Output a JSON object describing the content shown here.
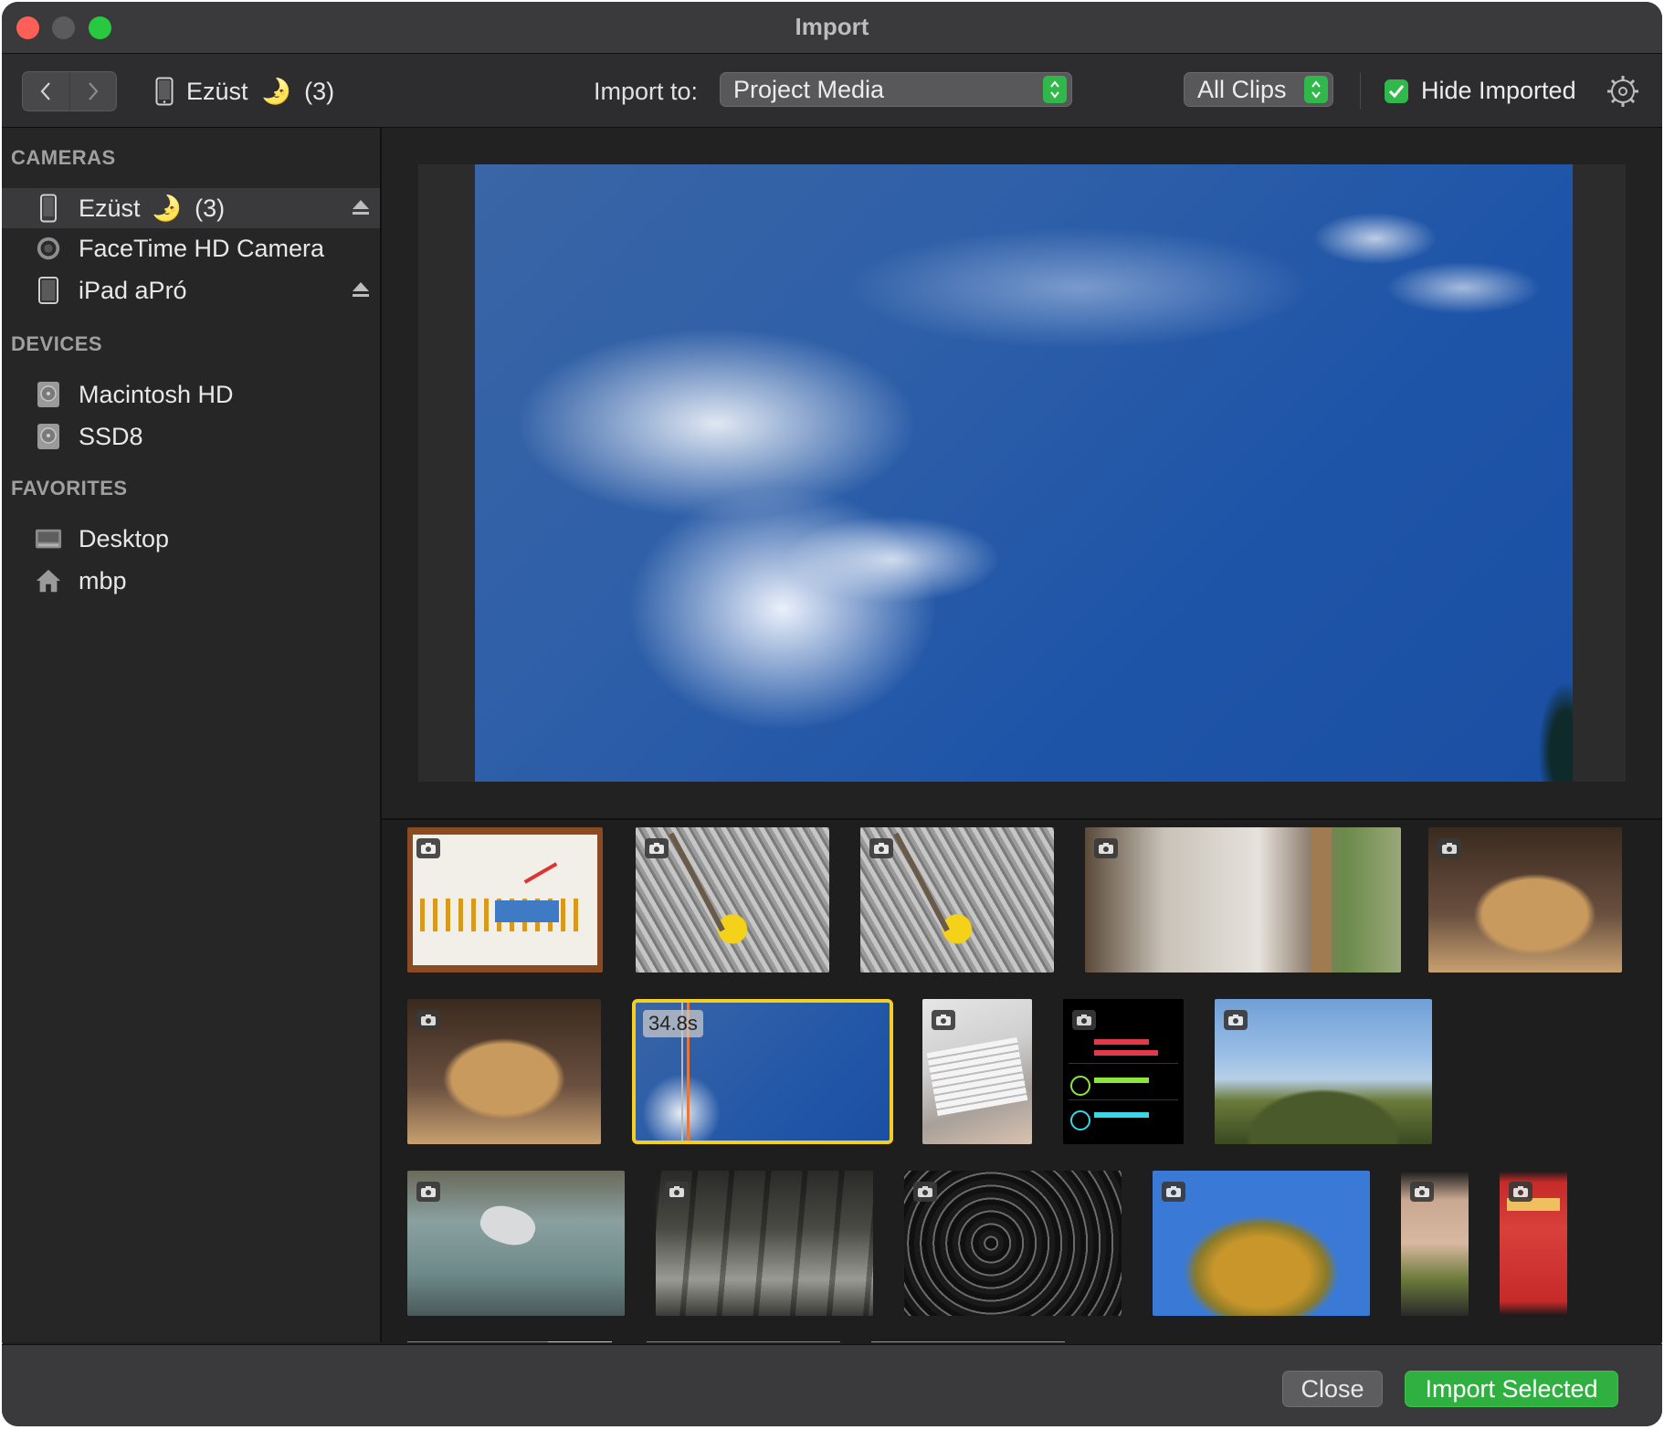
{
  "window": {
    "title": "Import"
  },
  "toolbar": {
    "device_name": "Ezüst",
    "device_emoji": "🌛",
    "device_count": "(3)",
    "import_to_label": "Import to:",
    "import_to_value": "Project Media",
    "filter_value": "All Clips",
    "hide_imported_label": "Hide Imported",
    "hide_imported_checked": true
  },
  "sidebar": {
    "cameras_header": "CAMERAS",
    "cameras": [
      {
        "label": "Ezüst",
        "emoji": "🌛",
        "count": "(3)",
        "icon": "iphone-icon",
        "selected": true,
        "ejectable": true
      },
      {
        "label": "FaceTime HD Camera",
        "icon": "camera-lens-icon",
        "selected": false,
        "ejectable": false
      },
      {
        "label": "iPad aPró",
        "icon": "ipad-icon",
        "selected": false,
        "ejectable": true
      }
    ],
    "devices_header": "DEVICES",
    "devices": [
      {
        "label": "Macintosh HD",
        "icon": "hard-drive-icon"
      },
      {
        "label": "SSD8",
        "icon": "hard-drive-icon"
      }
    ],
    "favorites_header": "FAVORITES",
    "favorites": [
      {
        "label": "Desktop",
        "icon": "desktop-icon"
      },
      {
        "label": "mbp",
        "icon": "home-icon"
      }
    ]
  },
  "clips": {
    "selected_duration": "34.8s"
  },
  "footer": {
    "close_label": "Close",
    "import_selected_label": "Import Selected"
  },
  "colors": {
    "accent_green": "#30b94a",
    "selection_yellow": "#f5cf1f",
    "playhead_orange": "#e8783a"
  }
}
